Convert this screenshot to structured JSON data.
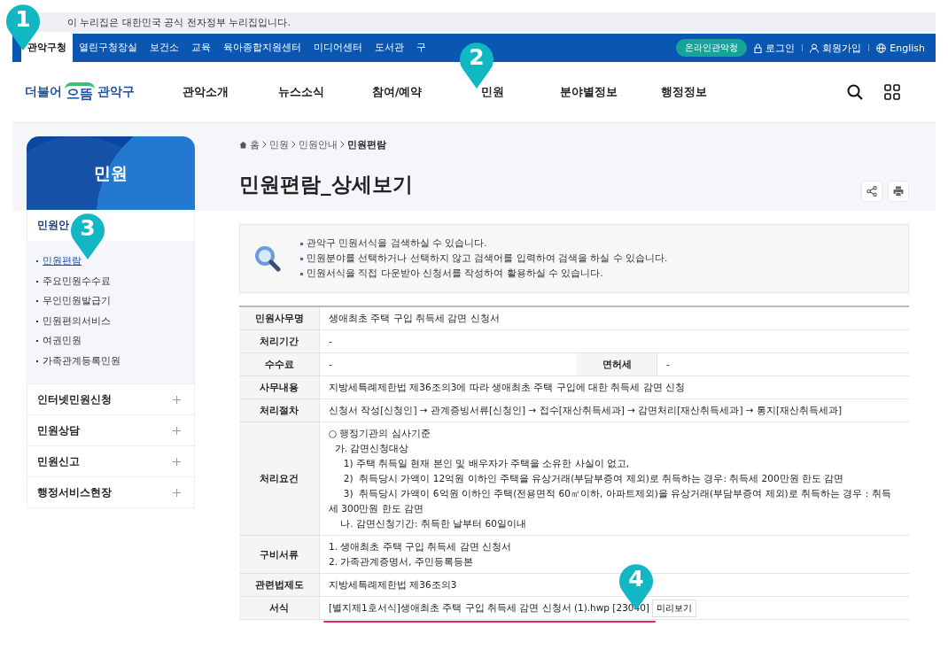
{
  "gov_banner": {
    "text": "이 누리집은 대한민국 공식 전자정부 누리집입니다."
  },
  "top_nav": {
    "items": [
      {
        "label": "관악구청",
        "selected": true
      },
      {
        "label": "열린구청장실",
        "selected": false
      },
      {
        "label": "보건소",
        "selected": false
      },
      {
        "label": "교육",
        "selected": false
      },
      {
        "label": "육아종합지원센터",
        "selected": false
      },
      {
        "label": "미디어센터",
        "selected": false
      },
      {
        "label": "도서관",
        "selected": false
      },
      {
        "label": "구",
        "selected": false
      }
    ],
    "online_button": "온라인관악청",
    "login": "로그인",
    "signup": "회원가입",
    "language": "English"
  },
  "logo": {
    "left": "더불어",
    "middle": "으뜸",
    "right": "관악구"
  },
  "main_menu": [
    "관악소개",
    "뉴스소식",
    "참여/예약",
    "민원",
    "분야별정보",
    "행정정보"
  ],
  "sidebar": {
    "title": "민원",
    "section": "민원안",
    "items": [
      {
        "label": "민원편람",
        "selected": true
      },
      {
        "label": "주요민원수수료",
        "selected": false
      },
      {
        "label": "무인민원발급기",
        "selected": false
      },
      {
        "label": "민원편의서비스",
        "selected": false
      },
      {
        "label": "여권민원",
        "selected": false
      },
      {
        "label": "가족관계등록민원",
        "selected": false
      }
    ],
    "groups": [
      {
        "label": "인터넷민원신청",
        "expanded": false
      },
      {
        "label": "민원상담",
        "expanded": false
      },
      {
        "label": "민원신고",
        "expanded": false
      },
      {
        "label": "행정서비스현장",
        "expanded": false
      }
    ]
  },
  "breadcrumb": [
    "홈",
    "민원",
    "민원안내",
    "민원편람"
  ],
  "page_title": "민원편람_상세보기",
  "info_notes": [
    "관악구 민원서식을 검색하실 수 있습니다.",
    "민원분야를 선택하거나 선택하지 않고 검색어를 입력하여 검색을 하실 수 있습니다.",
    "민원서식을 직접 다운받아 신청서를 작성하여 활용하실 수 있습니다."
  ],
  "table": {
    "rows": [
      {
        "kind": "text",
        "label": "민원사무명",
        "lines": [
          "생애최초 주택 구입 취득세 감면 신청서"
        ]
      },
      {
        "kind": "text",
        "label": "처리기간",
        "lines": [
          "-"
        ]
      },
      {
        "kind": "split",
        "label": "수수료",
        "value": "-",
        "label_2": "면허세",
        "value_2": "-"
      },
      {
        "kind": "text",
        "label": "사무내용",
        "lines": [
          "지방세특례제한법 제36조의3에 따라 생애최초 주택 구입에 대한 취득세 감면 신청"
        ]
      },
      {
        "kind": "text",
        "label": "처리절차",
        "lines": [
          "신청서 작성[신청인] → 관계증빙서류[신청인] → 접수[재산취득세과] → 감면처리[재산취득세과] → 통지[재산취득세과]"
        ]
      },
      {
        "kind": "text",
        "label": "처리요건",
        "lines": [
          "○ 행정기관의 심사기준",
          "  가. 감면신청대상",
          "     1) 주택 취득일 현재 본인 및 배우자가 주택을 소유한 사실이 없고,",
          "     2)  취득당시 가액이 12억원 이하인 주택을 유상거래(부담부증여 제외)로 취득하는 경우: 취득세 200만원 한도 감면",
          "     3)  취득당시 가액이 6억원 이하인 주택(전용면적 60㎡이하, 아파트제외)을 유상거래(부담부증여 제외)로 취득하는 경우 : 취득세 300만원 한도 감면",
          "    나. 감면신청기간: 취득한 날부터 60일이내"
        ]
      },
      {
        "kind": "text",
        "label": "구비서류",
        "lines": [
          "1. 생애최초 주택 구입 취득세 감면 신청서",
          "2. 가족관계증명서, 주민등록등본"
        ]
      },
      {
        "kind": "text",
        "label": "관련법제도",
        "lines": [
          "지방세특례제한법 제36조의3"
        ]
      },
      {
        "kind": "file",
        "label": "서식",
        "file": "[별지제1호서식]생애최초 주택 구입 취득세 감면 신청서 (1).hwp [23040]",
        "button": "미리보기",
        "underlined": true
      }
    ]
  },
  "markers": [
    {
      "label": "1"
    },
    {
      "label": "2"
    },
    {
      "label": "3"
    },
    {
      "label": "4"
    }
  ]
}
